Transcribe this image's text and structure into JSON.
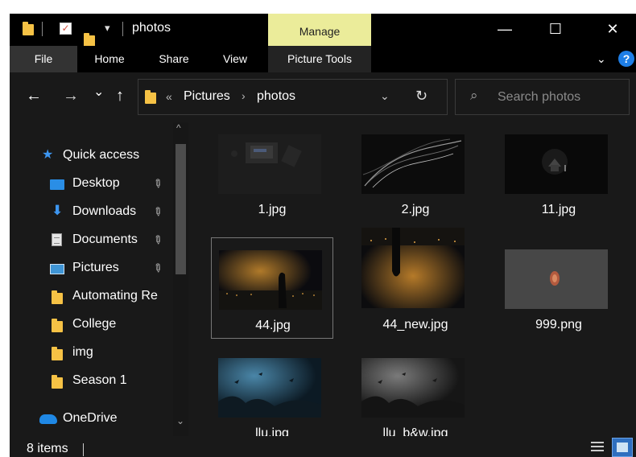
{
  "window": {
    "title": "photos",
    "controls": {
      "minimize": "—",
      "maximize": "☐",
      "close": "✕"
    },
    "qat_dropdown": "▾"
  },
  "ribbon": {
    "manage_label": "Manage",
    "tabs": [
      "File",
      "Home",
      "Share",
      "View",
      "Picture Tools"
    ],
    "collapse_glyph": "⌄",
    "help_glyph": "?"
  },
  "nav": {
    "back": "←",
    "forward": "→",
    "recent": "⌄",
    "up": "↑",
    "overflow": "«",
    "breadcrumb": [
      "Pictures",
      "photos"
    ],
    "crumb_sep": "›",
    "dropdown": "⌄",
    "refresh": "↻"
  },
  "search": {
    "placeholder": "Search photos",
    "icon": "⌕"
  },
  "sidebar": {
    "items": [
      {
        "label": "Quick access",
        "icon": "star-icon",
        "pinned": false
      },
      {
        "label": "Desktop",
        "icon": "desktop-icon",
        "pinned": true
      },
      {
        "label": "Downloads",
        "icon": "download-icon",
        "pinned": true
      },
      {
        "label": "Documents",
        "icon": "document-icon",
        "pinned": true
      },
      {
        "label": "Pictures",
        "icon": "pictures-icon",
        "pinned": true
      },
      {
        "label": "Automating Re",
        "icon": "folder-icon",
        "pinned": false
      },
      {
        "label": "College",
        "icon": "folder-icon",
        "pinned": false
      },
      {
        "label": "img",
        "icon": "folder-icon",
        "pinned": false
      },
      {
        "label": "Season 1",
        "icon": "folder-icon",
        "pinned": false
      },
      {
        "label": "OneDrive",
        "icon": "cloud-icon",
        "pinned": false
      }
    ],
    "pin_glyph": "📌",
    "scroll_up": "^",
    "scroll_down": "⌄"
  },
  "files": [
    {
      "name": "1.jpg",
      "selected": false
    },
    {
      "name": "2.jpg",
      "selected": false
    },
    {
      "name": "11.jpg",
      "selected": false
    },
    {
      "name": "44.jpg",
      "selected": true
    },
    {
      "name": "44_new.jpg",
      "selected": false
    },
    {
      "name": "999.png",
      "selected": false
    },
    {
      "name": "llu.jpg",
      "selected": false
    },
    {
      "name": "llu_b&w.jpg",
      "selected": false
    }
  ],
  "status": {
    "item_count": "8 items"
  },
  "colors": {
    "manage_tab": "#ebec9a",
    "accent_blue": "#1e7ee6",
    "folder_yellow": "#f6c245",
    "background": "#191919"
  }
}
